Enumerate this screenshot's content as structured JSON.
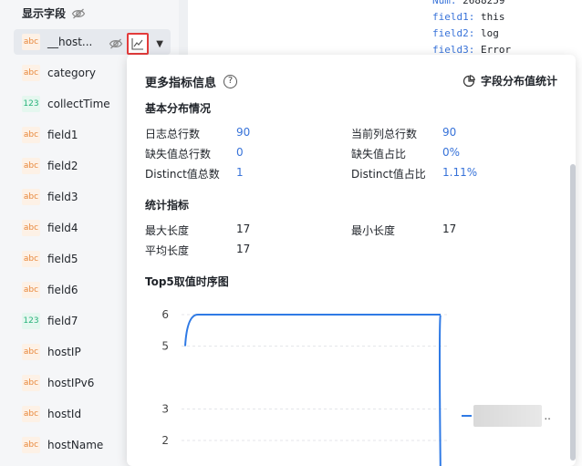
{
  "sidebar": {
    "section_title": "显示字段",
    "fields": [
      {
        "type": "abc",
        "name": "__host...",
        "active": true
      },
      {
        "type": "abc",
        "name": "category"
      },
      {
        "type": "123",
        "name": "collectTime"
      },
      {
        "type": "abc",
        "name": "field1"
      },
      {
        "type": "abc",
        "name": "field2"
      },
      {
        "type": "abc",
        "name": "field3"
      },
      {
        "type": "abc",
        "name": "field4"
      },
      {
        "type": "abc",
        "name": "field5"
      },
      {
        "type": "abc",
        "name": "field6"
      },
      {
        "type": "123",
        "name": "field7"
      },
      {
        "type": "abc",
        "name": "hostIP"
      },
      {
        "type": "abc",
        "name": "hostIPv6"
      },
      {
        "type": "abc",
        "name": "hostId"
      },
      {
        "type": "abc",
        "name": "hostName"
      }
    ]
  },
  "log_preview": {
    "lines": [
      {
        "key": "Num:",
        "value": " 2688259"
      },
      {
        "key": "field1:",
        "value": " this"
      },
      {
        "key": "field2:",
        "value": " log"
      },
      {
        "key": "field3:",
        "value": " Error"
      }
    ]
  },
  "popover": {
    "title": "更多指标信息",
    "help_icon": "question-circle-icon",
    "dist_link": "字段分布值统计",
    "basic_section": "基本分布情况",
    "basic_stats": [
      {
        "label": "日志总行数",
        "value": "90"
      },
      {
        "label": "当前列总行数",
        "value": "90"
      },
      {
        "label": "缺失值总行数",
        "value": "0"
      },
      {
        "label": "缺失值占比",
        "value": "0%"
      },
      {
        "label": "Distinct值总数",
        "value": "1"
      },
      {
        "label": "Distinct值占比",
        "value": "1.11%"
      }
    ],
    "metric_section": "统计指标",
    "metric_stats": [
      {
        "label": "最大长度",
        "value": "17"
      },
      {
        "label": "最小长度",
        "value": "17"
      },
      {
        "label": "平均长度",
        "value": "17"
      }
    ],
    "top5_section": "Top5取值时序图",
    "legend_suffix": ".."
  },
  "chart_data": {
    "type": "line",
    "title": "Top5取值时序图",
    "y_ticks": [
      "6",
      "5",
      "3",
      "2"
    ],
    "ylim": [
      1,
      6
    ],
    "grid": true,
    "series": [
      {
        "values": [
          5,
          6,
          6,
          6,
          6,
          6,
          6,
          6,
          6,
          6,
          6,
          6,
          6,
          6,
          6,
          6,
          6,
          6,
          6,
          6,
          6,
          6,
          6,
          6,
          6,
          6,
          6,
          6,
          6,
          6,
          6,
          6,
          6,
          6,
          6,
          6,
          6,
          0
        ],
        "color": "#2f7ae5"
      }
    ],
    "legend_position": "right"
  },
  "colors": {
    "accent": "#3873d9",
    "highlight_border": "#e33b3b",
    "line": "#2f7ae5"
  }
}
